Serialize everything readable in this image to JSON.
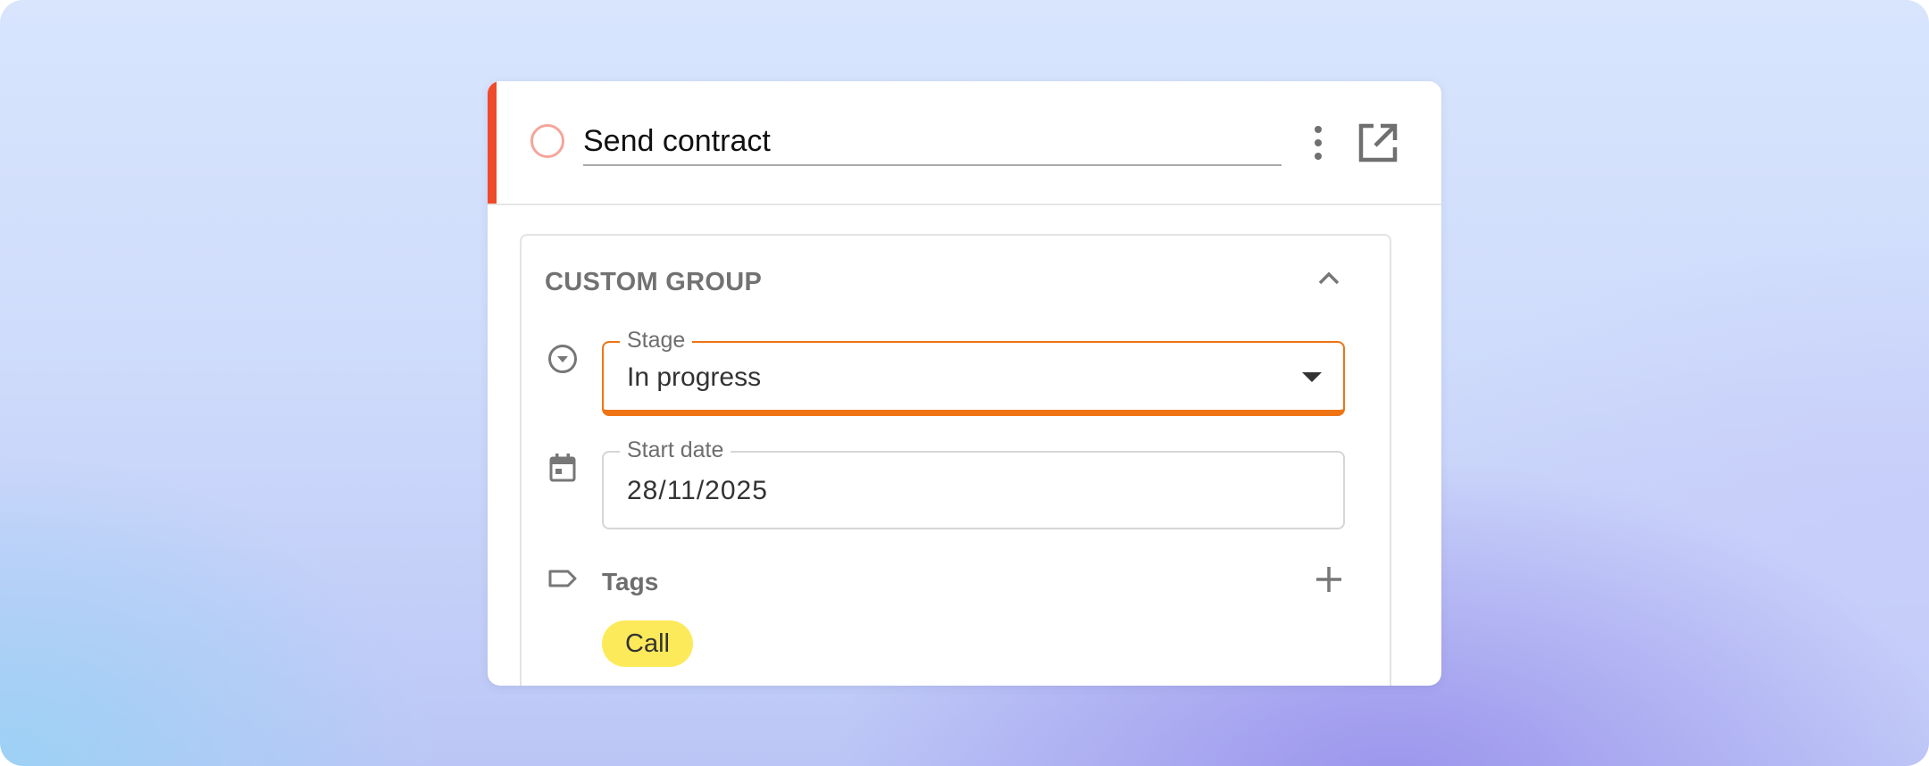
{
  "task": {
    "title": "Send contract",
    "accent_color": "#f04a2c",
    "status_icon": "circle-outline-icon",
    "actions": [
      {
        "name": "more-options",
        "icon": "more-vertical-icon"
      },
      {
        "name": "open-in-new",
        "icon": "open-in-new-icon"
      }
    ]
  },
  "group": {
    "title": "CUSTOM GROUP",
    "collapse_icon": "chevron-up-icon",
    "stage": {
      "label": "Stage",
      "value": "In progress",
      "icon": "dropdown-circle-icon",
      "focus_color": "#ef7414"
    },
    "start_date": {
      "label": "Start date",
      "value": "28/11/2025",
      "icon": "calendar-icon"
    },
    "tags": {
      "label": "Tags",
      "icon": "label-icon",
      "add_icon": "plus-icon",
      "items": [
        {
          "label": "Call",
          "color": "#fdea5a"
        }
      ]
    }
  }
}
